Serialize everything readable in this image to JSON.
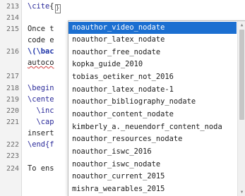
{
  "editor": {
    "lines": [
      {
        "num": "213",
        "prefix": "",
        "cmd": "\\cite",
        "rest": "{",
        "cursor": "}"
      },
      {
        "num": "214",
        "prefix": "",
        "cmd": "",
        "rest": "",
        "cursor": ""
      },
      {
        "num": "215",
        "prefix": "Once t",
        "cmd": "",
        "rest": "",
        "cursor": ""
      },
      {
        "num": "",
        "prefix": "code e",
        "cmd": "",
        "rest": "",
        "cursor": ""
      },
      {
        "num": "216",
        "prefix": "",
        "cmd": "\\(\\bac",
        "rest": "",
        "cursor": ""
      },
      {
        "num": "",
        "prefix": "autoco",
        "cmd": "",
        "rest": "",
        "cursor": ""
      },
      {
        "num": "217",
        "prefix": "",
        "cmd": "",
        "rest": "",
        "cursor": ""
      },
      {
        "num": "218",
        "prefix": "",
        "cmd": "\\begin",
        "rest": "",
        "cursor": ""
      },
      {
        "num": "219",
        "prefix": "",
        "cmd": "\\cente",
        "rest": "",
        "cursor": ""
      },
      {
        "num": "220",
        "prefix": "  ",
        "cmd": "\\inc",
        "rest": "",
        "cursor": ""
      },
      {
        "num": "221",
        "prefix": "  ",
        "cmd": "\\cap",
        "rest": "",
        "cursor": ""
      },
      {
        "num": "",
        "prefix": "insert",
        "cmd": "",
        "rest": "",
        "cursor": ""
      },
      {
        "num": "222",
        "prefix": "",
        "cmd": "\\end{f",
        "rest": "",
        "cursor": ""
      },
      {
        "num": "223",
        "prefix": "",
        "cmd": "",
        "rest": "",
        "cursor": ""
      },
      {
        "num": "224",
        "prefix": "To ens",
        "cmd": "",
        "rest": "",
        "cursor": ""
      }
    ]
  },
  "autocomplete": {
    "items": [
      "noauthor_video_nodate",
      "noauthor_latex_nodate",
      "noauthor_free_nodate",
      "kopka_guide_2010",
      "tobias_oetiker_not_2016",
      "noauthor_latex_nodate-1",
      "noauthor_bibliography_nodate",
      "noauthor_content_nodate",
      "kimberly_a._neuendorf_content_noda",
      "noauthor_resources_nodate",
      "noauthor_iswc_2016",
      "noauthor_iswc_nodate",
      "noauthor_current_2015",
      "mishra_wearables_2015"
    ],
    "selected_index": 0,
    "scroll_up": "▲",
    "scroll_down": "▼"
  },
  "colors": {
    "selection": "#1b6fd1",
    "command": "#1d33a8",
    "gutter": "#f3f3f3"
  }
}
